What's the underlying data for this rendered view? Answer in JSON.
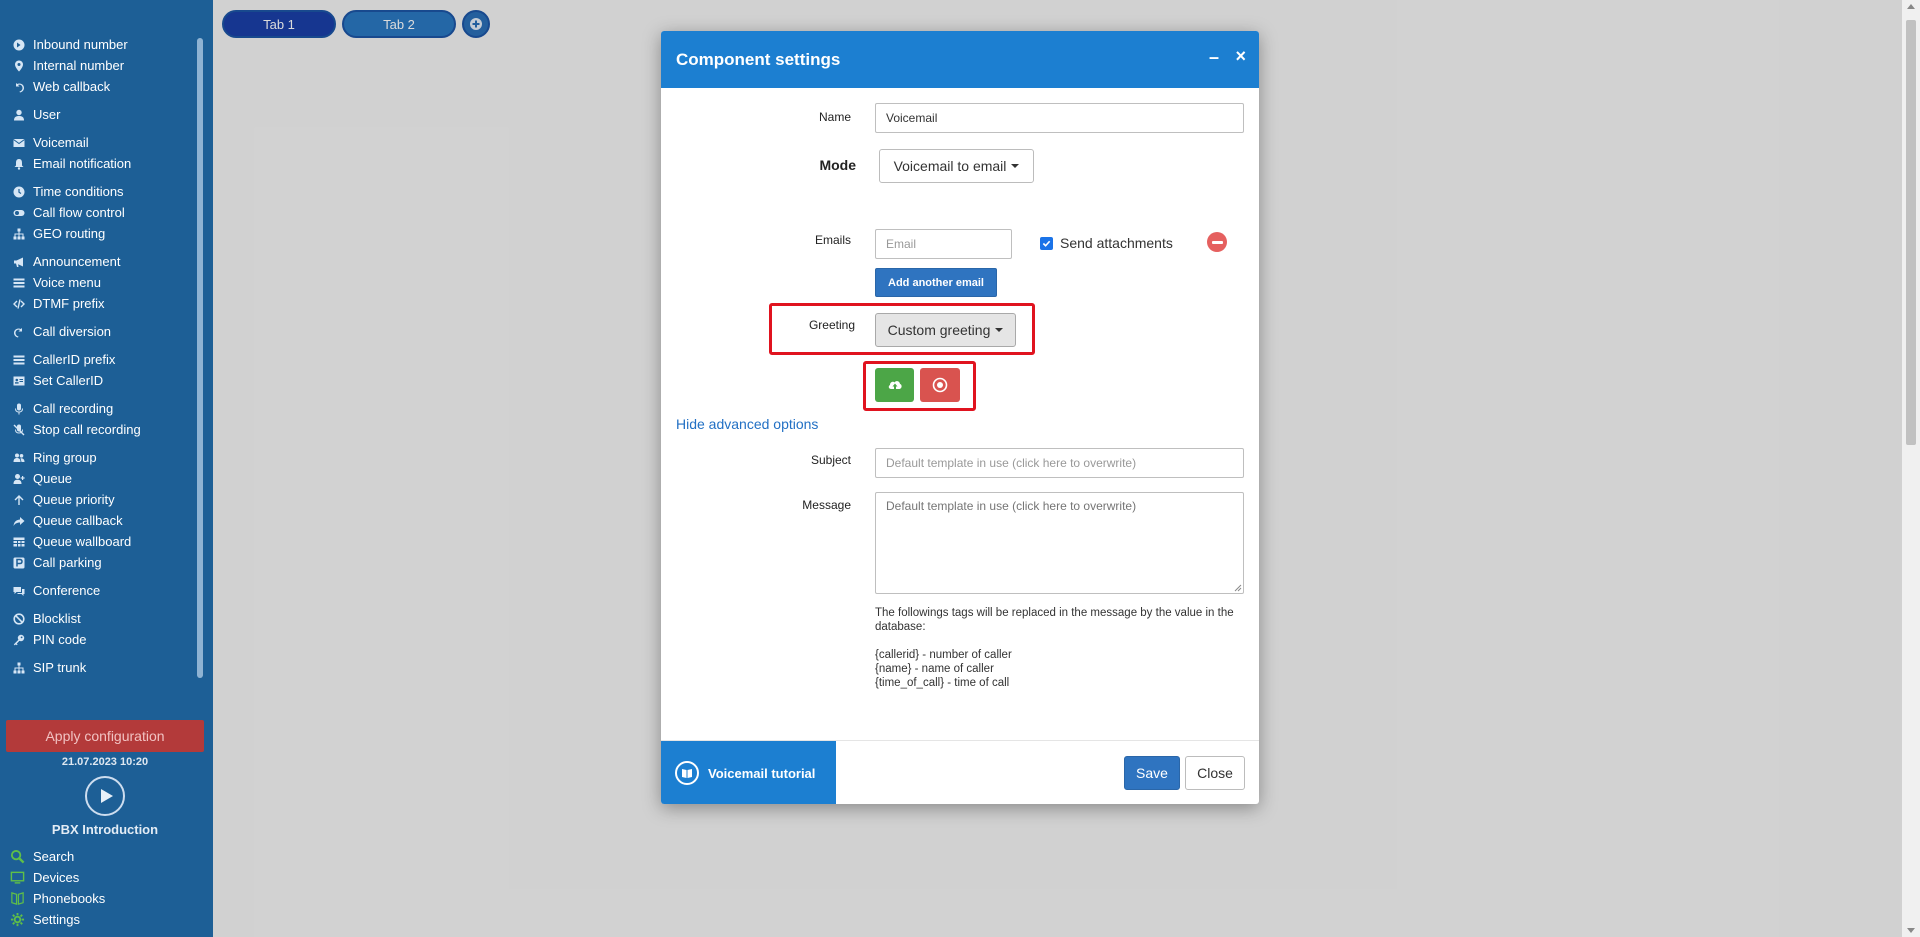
{
  "sidebar": {
    "groups": [
      [
        {
          "label": "Inbound number",
          "icon": "arrow-circle-right-icon"
        },
        {
          "label": "Internal number",
          "icon": "map-pin-icon"
        },
        {
          "label": "Web callback",
          "icon": "undo-icon"
        }
      ],
      [
        {
          "label": "User",
          "icon": "user-icon"
        }
      ],
      [
        {
          "label": "Voicemail",
          "icon": "envelope-icon"
        },
        {
          "label": "Email notification",
          "icon": "bell-icon"
        }
      ],
      [
        {
          "label": "Time conditions",
          "icon": "clock-icon"
        },
        {
          "label": "Call flow control",
          "icon": "toggle-icon"
        },
        {
          "label": "GEO routing",
          "icon": "sitemap-icon"
        }
      ],
      [
        {
          "label": "Announcement",
          "icon": "bullhorn-icon"
        },
        {
          "label": "Voice menu",
          "icon": "list-icon"
        },
        {
          "label": "DTMF prefix",
          "icon": "code-icon"
        }
      ],
      [
        {
          "label": "Call diversion",
          "icon": "redo-icon"
        }
      ],
      [
        {
          "label": "CallerID prefix",
          "icon": "list-icon"
        },
        {
          "label": "Set CallerID",
          "icon": "id-card-icon"
        }
      ],
      [
        {
          "label": "Call recording",
          "icon": "microphone-icon"
        },
        {
          "label": "Stop call recording",
          "icon": "microphone-slash-icon"
        }
      ],
      [
        {
          "label": "Ring group",
          "icon": "users-icon"
        },
        {
          "label": "Queue",
          "icon": "user-plus-icon"
        },
        {
          "label": "Queue priority",
          "icon": "arrow-up-icon"
        },
        {
          "label": "Queue callback",
          "icon": "share-icon"
        },
        {
          "label": "Queue wallboard",
          "icon": "table-icon"
        },
        {
          "label": "Call parking",
          "icon": "parking-icon"
        }
      ],
      [
        {
          "label": "Conference",
          "icon": "comments-icon"
        }
      ],
      [
        {
          "label": "Blocklist",
          "icon": "ban-icon"
        },
        {
          "label": "PIN code",
          "icon": "key-icon"
        }
      ],
      [
        {
          "label": "SIP trunk",
          "icon": "sitemap-icon"
        }
      ]
    ],
    "apply_label": "Apply configuration",
    "apply_date": "21.07.2023 10:20",
    "intro_label": "PBX Introduction",
    "bottom": [
      {
        "label": "Search",
        "icon": "search-icon"
      },
      {
        "label": "Devices",
        "icon": "monitor-icon"
      },
      {
        "label": "Phonebooks",
        "icon": "book-icon"
      },
      {
        "label": "Settings",
        "icon": "gear-icon"
      }
    ]
  },
  "tabs": [
    {
      "label": "Tab 1",
      "active": true
    },
    {
      "label": "Tab 2",
      "active": false
    }
  ],
  "modal": {
    "title": "Component settings",
    "name_label": "Name",
    "name_value": "Voicemail",
    "mode_label": "Mode",
    "mode_value": "Voicemail to email",
    "emails_label": "Emails",
    "email_placeholder": "Email",
    "send_attachments_label": "Send attachments",
    "send_attachments_checked": true,
    "add_email_label": "Add another email",
    "greeting_label": "Greeting",
    "greeting_value": "Custom greeting",
    "advanced_link": "Hide advanced options",
    "subject_label": "Subject",
    "subject_placeholder": "Default template in use (click here to overwrite)",
    "message_label": "Message",
    "message_placeholder": "Default template in use (click here to overwrite)",
    "tags_intro": "The followings tags will be replaced in the message by the value in the database:",
    "tags": [
      "{callerid} - number of caller",
      "{name} - name of caller",
      "{time_of_call} - time of call"
    ],
    "tutorial_label": "Voicemail tutorial",
    "save_label": "Save",
    "close_label": "Close"
  },
  "colors": {
    "sidebar_bg": "#1d5f96",
    "header_blue": "#1c7fd1",
    "primary_button": "#2f74c0",
    "upload_green": "#4ca647",
    "record_red": "#d9534f",
    "highlight_red": "#e0131f"
  }
}
